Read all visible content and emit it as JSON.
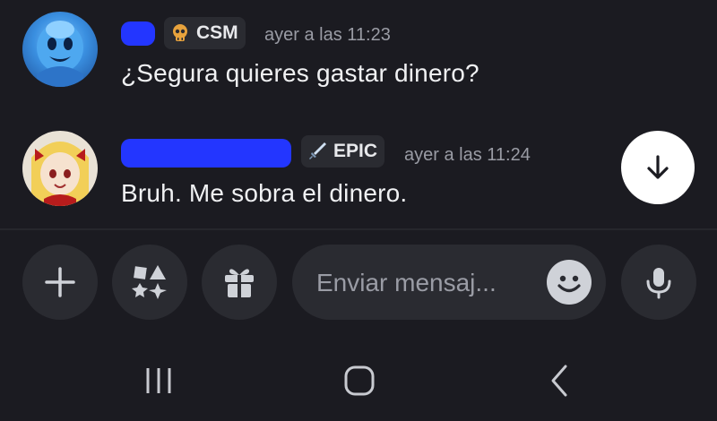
{
  "messages": [
    {
      "author": "",
      "role": {
        "label": "CSM",
        "icon": "skull-icon",
        "color": "#e8a33d"
      },
      "timestamp": "ayer a las 11:23",
      "text": "¿Segura quieres gastar dinero?"
    },
    {
      "author": "",
      "role": {
        "label": "EPIC",
        "icon": "sword-icon",
        "color": "#9bb6d6"
      },
      "timestamp": "ayer a las 11:24",
      "text": "Bruh. Me sobra el dinero."
    }
  ],
  "composer": {
    "placeholder": "Enviar mensaj..."
  },
  "colors": {
    "background": "#1b1b21",
    "button_bg": "#2a2b31",
    "redaction": "#2336ff"
  }
}
